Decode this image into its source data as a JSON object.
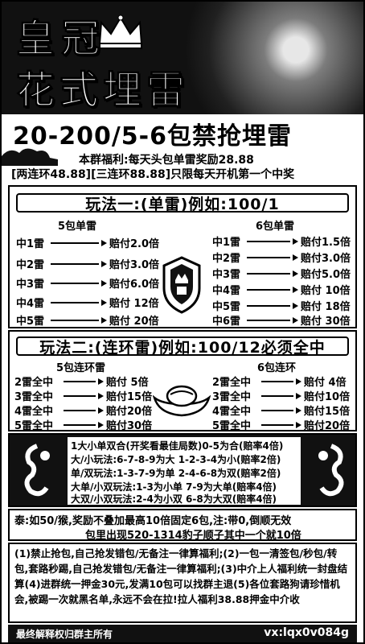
{
  "header": {
    "title_line1": "皇冠",
    "title_line2": "花式埋雷",
    "headline": "20-200/5-6包禁抢埋雷",
    "bonus_line1": "本群福利:每天头包单雷奖励28.88",
    "bonus_line2": "[两连环48.88][三连环88.88]只限每天开机第一个中奖"
  },
  "section1": {
    "title": "玩法一:(单雷)例如:100/1",
    "left_head": "5包单雷",
    "right_head": "6包单雷",
    "left_rows": [
      {
        "label": "中1雷",
        "pay": "赔付2.0倍"
      },
      {
        "label": "中2雷",
        "pay": "赔付3.0倍"
      },
      {
        "label": "中3雷",
        "pay": "赔付6.0倍"
      },
      {
        "label": "中4雷",
        "pay": "赔付 12倍"
      },
      {
        "label": "中5雷",
        "pay": "赔付 20倍"
      }
    ],
    "right_rows": [
      {
        "label": "中1雷",
        "pay": "赔付1.5倍"
      },
      {
        "label": "中2雷",
        "pay": "赔付3.0倍"
      },
      {
        "label": "中3雷",
        "pay": "赔付5.0倍"
      },
      {
        "label": "中4雷",
        "pay": "赔付 10倍"
      },
      {
        "label": "中5雷",
        "pay": "赔付 18倍"
      },
      {
        "label": "中6雷",
        "pay": "赔付 30倍"
      }
    ]
  },
  "section2": {
    "title": "玩法二:(连环雷)例如:100/12必须全中",
    "left_head": "5包连环雷",
    "right_head": "6包连环",
    "left_rows": [
      {
        "label": "2雷全中",
        "pay": "赔付 5倍"
      },
      {
        "label": "3雷全中",
        "pay": "赔付15倍"
      },
      {
        "label": "4雷全中",
        "pay": "赔付20倍"
      },
      {
        "label": "5雷全中",
        "pay": "赔付30倍"
      }
    ],
    "right_rows": [
      {
        "label": "2雷全中",
        "pay": "赔付 4倍"
      },
      {
        "label": "3雷全中",
        "pay": "赔付10倍"
      },
      {
        "label": "4雷全中",
        "pay": "赔付15倍"
      },
      {
        "label": "5雷全中",
        "pay": "赔付20倍"
      }
    ]
  },
  "games": [
    "1大小单双合(开奖看最佳局数)0-5为合(赔率4倍)",
    "大/小玩法:6-7-8-9为大 1-2-3-4为小(赔率2倍)",
    "单/双玩法:1-3-7-9为单 2-4-6-8为双(赔率2倍)",
    "大单/小双玩法:1-3为小单 7-9为大单(赔率4倍)",
    "大双/小双玩法:2-4为小双 6-8为大双(赔率4倍)"
  ],
  "notice": {
    "line1": "泰:如50/猴,奖励不叠加最高10倍固定6包,注:带0,倒顺无效",
    "line2": "包里出现520-1314豹子顺子其中一个就10倍"
  },
  "rules": "(1)禁止抢包,自己抢发错包/无备注一律算福利;(2)一包一清签包/秒包/转包,套路秒踢,自己抢发错包/无备注一律算福利;(3)中介上人福利统一封盘结算(4)进群统一押金30元,发满10包可以找群主退(5)各位套路狗请珍惜机会,被踢一次就黑名单,永远不会在拉!拉人福利38.88押金中介收",
  "footer": {
    "left": "最终解释权归群主所有",
    "right": "vx:lqx0v084g"
  }
}
